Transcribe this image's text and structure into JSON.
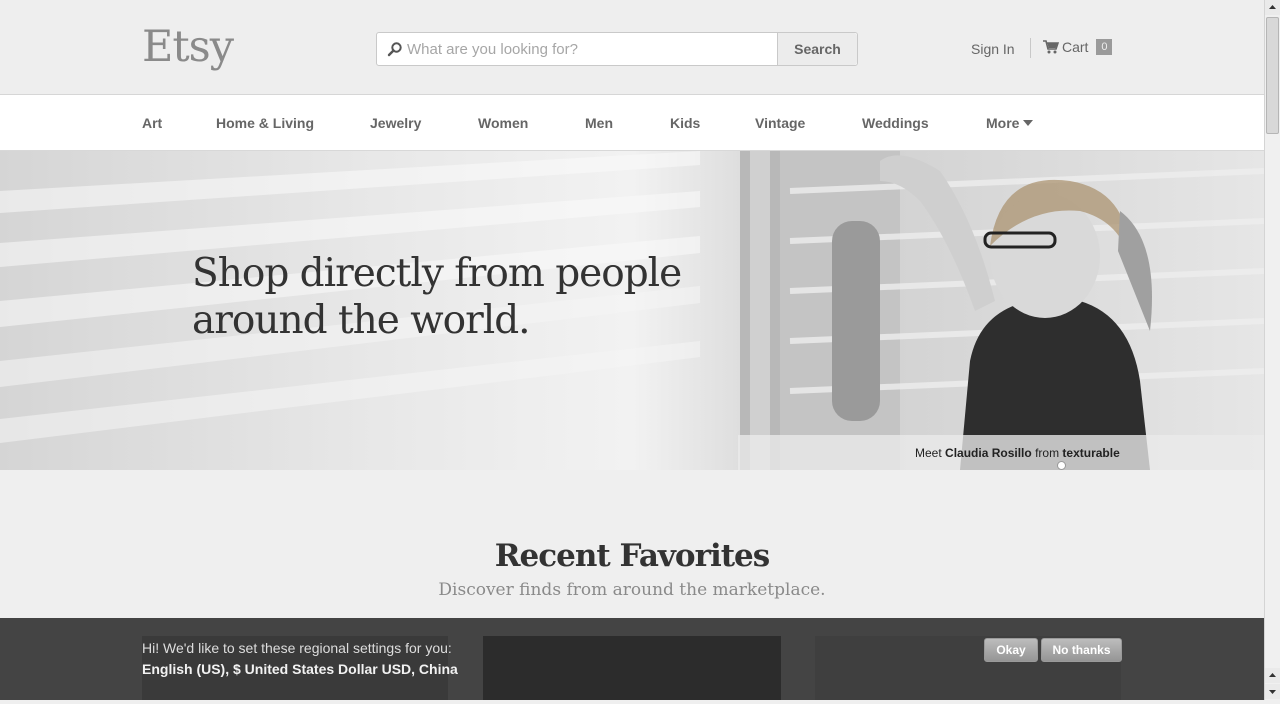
{
  "header": {
    "logo": "Etsy",
    "search": {
      "placeholder": "What are you looking for?",
      "button_label": "Search"
    },
    "signin_label": "Sign In",
    "cart": {
      "label": "Cart",
      "count": "0"
    }
  },
  "nav": {
    "items": [
      "Art",
      "Home & Living",
      "Jewelry",
      "Women",
      "Men",
      "Kids",
      "Vintage",
      "Weddings"
    ],
    "more_label": "More"
  },
  "hero": {
    "title_line1": "Shop directly from people",
    "title_line2": "around the world.",
    "caption": {
      "prefix": "Meet",
      "name": "Claudia Rosillo",
      "middle": "from",
      "shop": "texturable"
    }
  },
  "recent_favorites": {
    "title": "Recent Favorites",
    "subtitle": "Discover finds from around the marketplace."
  },
  "region_banner": {
    "line1": "Hi! We'd like to set these regional settings for you:",
    "line2": "English (US), $ United States Dollar USD, China",
    "okay_label": "Okay",
    "no_thanks_label": "No thanks"
  },
  "icons": {
    "search": "search-icon",
    "cart": "cart-icon",
    "more": "caret-down-icon"
  },
  "colors": {
    "background": "#efefef",
    "header_bg": "#eeeeee",
    "banner_bg": "#444444",
    "text_dark": "#333333"
  }
}
